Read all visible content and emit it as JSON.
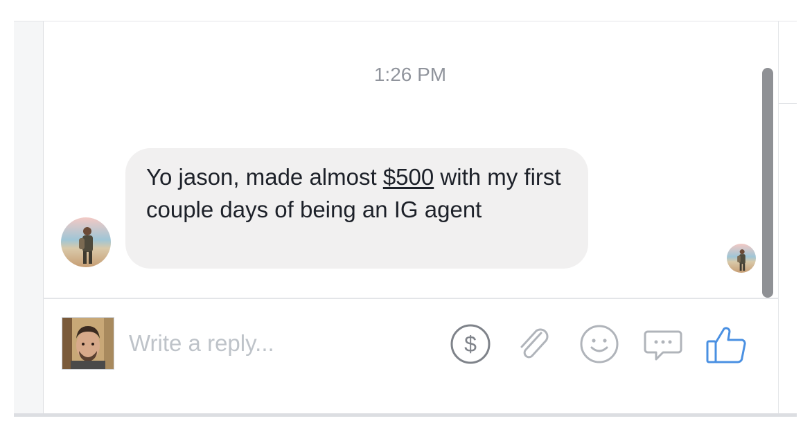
{
  "conversation": {
    "timestamp": "1:26 PM",
    "message": {
      "text_before": "Yo jason, made almost ",
      "amount": "$500",
      "text_after": " with my first couple days of being an IG agent"
    }
  },
  "composer": {
    "placeholder": "Write a reply..."
  },
  "icons": {
    "payment": "dollar-circle-icon",
    "attach": "paperclip-icon",
    "emoji": "smiley-icon",
    "sticker": "chat-bubble-dots-icon",
    "like": "thumbs-up-icon"
  },
  "colors": {
    "accent": "#4a90e2",
    "icon_gray": "#90949c",
    "bubble": "#f1f0f0",
    "timestamp": "#90949c",
    "scrollbar": "#8f9195"
  }
}
